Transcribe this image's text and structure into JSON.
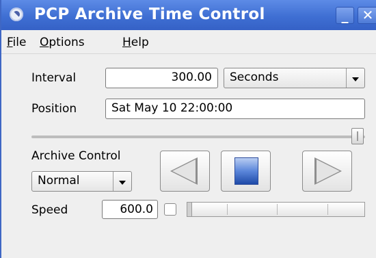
{
  "window": {
    "title": "PCP Archive Time Control",
    "minimize_glyph": "_",
    "close_glyph": "✕"
  },
  "menu": {
    "items": [
      {
        "mnemonic": "F",
        "rest": "ile"
      },
      {
        "mnemonic": "O",
        "rest": "ptions"
      },
      {
        "mnemonic": "H",
        "rest": "elp"
      }
    ]
  },
  "form": {
    "interval_label": "Interval",
    "interval_value": "300.00",
    "interval_unit": "Seconds",
    "position_label": "Position",
    "position_value": "Sat May 10 22:00:00",
    "position_slider_fraction": 1.0,
    "archive_control_label": "Archive Control",
    "archive_mode": "Normal",
    "speed_label": "Speed",
    "speed_value": "600.0",
    "speed_checkbox_checked": false
  },
  "icons": {
    "app": "pcp-app-icon",
    "rewind": "play-backward-icon",
    "stop": "stop-icon",
    "play": "play-forward-icon"
  },
  "colors": {
    "titlebar": "#3f6fd3",
    "stop_button_fill": "#5b86da"
  }
}
